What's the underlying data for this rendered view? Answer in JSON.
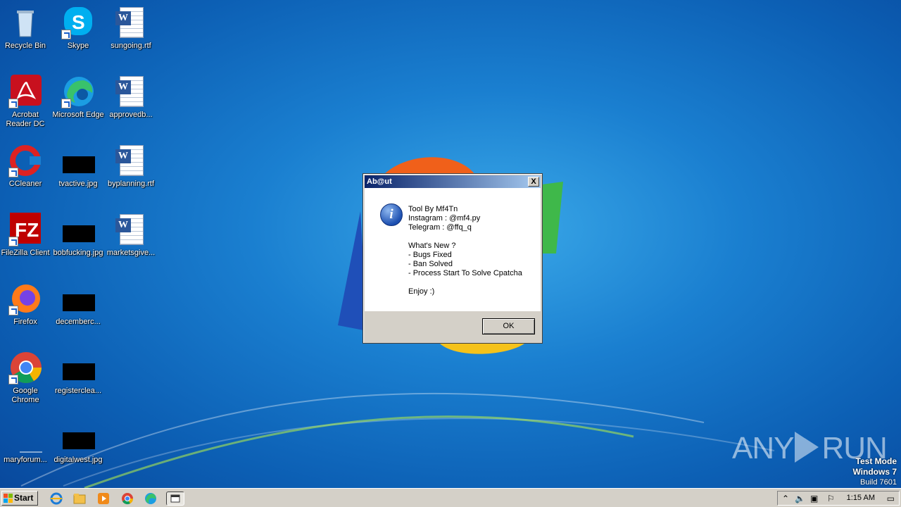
{
  "desktop": {
    "icons": [
      {
        "label": "Recycle Bin"
      },
      {
        "label": "Skype"
      },
      {
        "label": "sungoing.rtf"
      },
      {
        "label": "Acrobat Reader DC"
      },
      {
        "label": "Microsoft Edge"
      },
      {
        "label": "approvedb..."
      },
      {
        "label": "CCleaner"
      },
      {
        "label": "tvactive.jpg"
      },
      {
        "label": "byplanning.rtf"
      },
      {
        "label": "FileZilla Client"
      },
      {
        "label": "bobfucking.jpg"
      },
      {
        "label": "marketsgive..."
      },
      {
        "label": "Firefox"
      },
      {
        "label": "decemberc..."
      },
      {
        "label": "Google Chrome"
      },
      {
        "label": "registerclea..."
      },
      {
        "label": "maryforum..."
      },
      {
        "label": "digitalwest.jpg"
      }
    ]
  },
  "dialog": {
    "title": "Ab@ut",
    "close_label": "X",
    "info_glyph": "i",
    "lines": [
      "Tool By Mf4Tn",
      "Instagram : @mf4.py",
      "Telegram : @ffq_q",
      "",
      "What's New ?",
      "- Bugs Fixed",
      "- Ban Solved",
      "- Process Start To Solve Cpatcha",
      "",
      "Enjoy :)"
    ],
    "ok_label": "OK"
  },
  "watermark": {
    "left": "ANY",
    "right": "RUN"
  },
  "os_info": {
    "line1": "Test Mode",
    "line2": "Windows 7",
    "line3": "Build 7601"
  },
  "taskbar": {
    "start_label": "Start",
    "clock": "1:15 AM",
    "pinned": [
      "internet-explorer-icon",
      "file-explorer-icon",
      "media-player-icon",
      "chrome-icon",
      "edge-icon",
      "about-app-icon"
    ]
  },
  "colors": {
    "titlebar_start": "#0a246a",
    "titlebar_end": "#a6caf0",
    "desktop": "#1a7fd0",
    "taskbar": "#d4d0c8"
  }
}
